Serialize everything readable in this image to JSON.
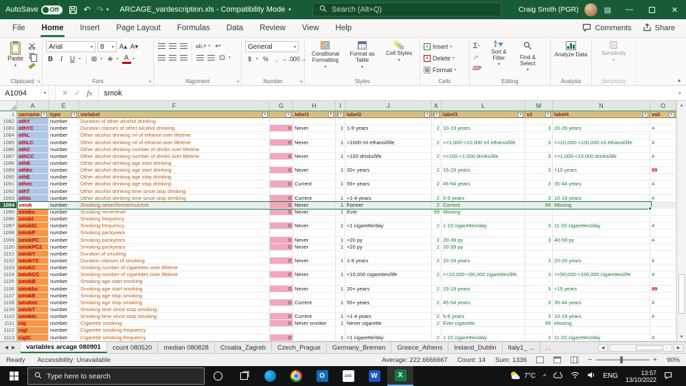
{
  "title_bar": {
    "autosave_label": "AutoSave",
    "autosave_state": "Off",
    "title": "ARCAGE_vardescription.xls  -  Compatibility Mode",
    "search_placeholder": "Search (Alt+Q)",
    "user_name": "Craig Smith (PGR)"
  },
  "menu": {
    "tabs": [
      "File",
      "Home",
      "Insert",
      "Page Layout",
      "Formulas",
      "Data",
      "Review",
      "View",
      "Help"
    ],
    "active_tab": "Home",
    "comments_label": "Comments",
    "share_label": "Share"
  },
  "ribbon": {
    "font_name": "Arial",
    "font_size": "8",
    "number_format": "General",
    "groups": [
      "Clipboard",
      "Font",
      "Alignment",
      "Number",
      "Styles",
      "Cells",
      "Editing",
      "Analysis",
      "Sensitivity"
    ],
    "buttons": {
      "paste": "Paste",
      "conditional": "Conditional Formatting",
      "format_table": "Format as Table",
      "cell_styles": "Cell Styles",
      "insert": "Insert",
      "delete": "Delete",
      "format": "Format",
      "sort_filter": "Sort & Filter",
      "find_select": "Find & Select",
      "analyze": "Analyze Data",
      "sensitivity": "Sensitivity"
    }
  },
  "formula_bar": {
    "name_box": "A1094",
    "fx": "fx",
    "content": "smok"
  },
  "grid": {
    "columns": [
      "A",
      "E",
      "F",
      "G",
      "H",
      "I",
      "J",
      "K",
      "L",
      "M",
      "N",
      "O"
    ],
    "header_row": {
      "num": "1",
      "cells": [
        "varname",
        "type",
        "varlabel",
        "",
        "label1",
        "v",
        "label2",
        "v",
        "label3",
        "v2",
        "label4",
        "vali"
      ]
    },
    "rows": [
      {
        "num": "1082",
        "ac": "b",
        "a": "othY",
        "e": "number",
        "f": "Duration of other alcohol drinking"
      },
      {
        "num": "1083",
        "ac": "b",
        "a": "othYC",
        "e": "number",
        "f": "Duration classes of other alcohol drinking",
        "g": "0",
        "h": "Never",
        "i": "1",
        "j": "1-9 years",
        "k": "2",
        "l": "10-19 years",
        "m": "3",
        "n": "20-29 years",
        "o": "4"
      },
      {
        "num": "1084",
        "ac": "b",
        "a": "othL",
        "e": "number",
        "f": "Other alcohol drinking ml of ethanol over lifetime"
      },
      {
        "num": "1085",
        "ac": "b",
        "a": "othLC",
        "e": "number",
        "f": "Other alcohol drinking ml of ethanol over lifetime",
        "g": "0",
        "h": "Never",
        "i": "1",
        "j": "<1000 ml ethanol/life",
        "k": "2",
        "l": ">=1,000-<10,000 ml ethanol/life",
        "m": "3",
        "n": ">=10,000-<100,000 ml ethanol/life",
        "o": "4"
      },
      {
        "num": "1086",
        "ac": "b",
        "a": "othC",
        "e": "number",
        "f": "Other alcohol drinking number of drinks over lifetime"
      },
      {
        "num": "1087",
        "ac": "b",
        "a": "othCC",
        "e": "number",
        "f": "Other alcohol drinking number of drinks over lifetime",
        "g": "0",
        "h": "Never",
        "i": "1",
        "j": "<100 drinks/life",
        "k": "2",
        "l": ">=100-<1,000 drinks/life",
        "m": "3",
        "n": ">=1,000-<10,000 drinks/life",
        "o": "4"
      },
      {
        "num": "1088",
        "ac": "b",
        "a": "othB",
        "e": "number",
        "f": "Other alcohol drinking age start drinking"
      },
      {
        "num": "1089",
        "ac": "b",
        "a": "othbc",
        "e": "number",
        "f": "Other alcohol drinking age start drinking",
        "g": "0",
        "h": "Never",
        "i": "1",
        "j": "20+ years",
        "k": "2",
        "l": "15-19 years",
        "m": "3",
        "n": "<15 years",
        "o": "99"
      },
      {
        "num": "1090",
        "ac": "b",
        "a": "othE",
        "e": "number",
        "f": "Other alcohol drinking age stop drinking"
      },
      {
        "num": "1091",
        "ac": "b",
        "a": "othec",
        "e": "number",
        "f": "Other alcohol drinking age stop drinking",
        "g": "0",
        "h": "Current",
        "i": "1",
        "j": "55+ years",
        "k": "2",
        "l": "45-54 years",
        "m": "3",
        "n": "35-44 years",
        "o": "4"
      },
      {
        "num": "1092",
        "ac": "b",
        "a": "othT",
        "e": "number",
        "f": "Other alcohol drinking time since stop drinking"
      },
      {
        "num": "1093",
        "ac": "b",
        "a": "othtc",
        "e": "number",
        "f": "Other alcohol drinking time since stop drinking",
        "g": "0",
        "h": "Current",
        "i": "1",
        "j": ">1-4 years",
        "k": "2",
        "l": "5-9 years",
        "m": "3",
        "n": "10-19 years",
        "o": "4"
      },
      {
        "num": "1094",
        "ac": "s",
        "sel": true,
        "a": "smok",
        "e": "number",
        "f": "Smoking never/former/current",
        "g": "0",
        "h": "Never",
        "i": "1",
        "j": "Former",
        "k": "2",
        "l": "Current",
        "m": "99",
        "n": "Missing"
      },
      {
        "num": "1095",
        "ac": "o",
        "a": "smoks",
        "e": "number",
        "f": "Smoking never/ever",
        "g": "0",
        "h": "Never",
        "i": "1",
        "j": "Ever",
        "k": "99",
        "l": "Missing"
      },
      {
        "num": "1096",
        "ac": "o",
        "a": "smokl",
        "e": "number",
        "f": "Smoking frequency"
      },
      {
        "num": "1097",
        "ac": "o",
        "a": "smoklC",
        "e": "number",
        "f": "Smoking frequency",
        "g": "0",
        "h": "Never",
        "i": "1",
        "j": "<1 cigarette/day",
        "k": "2",
        "l": "1-10 cigarettes/day",
        "m": "3",
        "n": "11-20 cigarettes/day",
        "o": "4"
      },
      {
        "num": "1098",
        "ac": "o",
        "a": "smokP",
        "e": "number",
        "f": "Smoking packyears"
      },
      {
        "num": "1099",
        "ac": "o",
        "a": "smokPC",
        "e": "number",
        "f": "Smoking packyears",
        "g": "0",
        "h": "Never",
        "i": "1",
        "j": "<20 py",
        "k": "2",
        "l": "20-39 py",
        "m": "3",
        "n": "40-59 py",
        "o": "4"
      },
      {
        "num": "1100",
        "ac": "o",
        "a": "smokPC2",
        "e": "number",
        "f": "Smoking packyears",
        "g": "0",
        "h": "Never",
        "i": "1",
        "j": "<20 py",
        "k": "2",
        "l": "20-39 py"
      },
      {
        "num": "1101",
        "ac": "o",
        "a": "smokY",
        "e": "number",
        "f": "Duration of smoking"
      },
      {
        "num": "1102",
        "ac": "o",
        "a": "smokYC",
        "e": "number",
        "f": "Duration classes of smoking",
        "g": "0",
        "h": "Never",
        "i": "1",
        "j": "1-9 years",
        "k": "2",
        "l": "10-19 years",
        "m": "3",
        "n": "20-29 years",
        "o": "4"
      },
      {
        "num": "1103",
        "ac": "o",
        "a": "smokC",
        "e": "number",
        "f": "Smoking number of cigarettes over lifetime"
      },
      {
        "num": "1104",
        "ac": "o",
        "a": "smokCC",
        "e": "number",
        "f": "Smoking number of cigarettes over lifetime",
        "g": "0",
        "h": "Never",
        "i": "1",
        "j": "<10,000 cigarettes/life",
        "k": "2",
        "l": ">=10,000-<50,000 cigarettes/life",
        "m": "3",
        "n": ">=50,000-<100,000 cigarettes/life",
        "o": "4"
      },
      {
        "num": "1105",
        "ac": "o",
        "a": "smokB",
        "e": "number",
        "f": "Smoking age start smoking"
      },
      {
        "num": "1106",
        "ac": "o",
        "a": "smokbc",
        "e": "number",
        "f": "Smoking age start smoking",
        "g": "0",
        "h": "Never",
        "i": "1",
        "j": "20+ years",
        "k": "2",
        "l": "15-19 years",
        "m": "3",
        "n": "<15 years",
        "o": "99"
      },
      {
        "num": "1107",
        "ac": "o",
        "a": "smokE",
        "e": "number",
        "f": "Smoking age stop smoking"
      },
      {
        "num": "1108",
        "ac": "o",
        "a": "smokec",
        "e": "number",
        "f": "Smoking age stop smoking",
        "g": "0",
        "h": "Current",
        "i": "1",
        "j": "55+ years",
        "k": "2",
        "l": "45-54 years",
        "m": "3",
        "n": "35-44 years",
        "o": "4"
      },
      {
        "num": "1109",
        "ac": "o",
        "a": "smokT",
        "e": "number",
        "f": "Smoking time since stop smoking"
      },
      {
        "num": "1110",
        "ac": "o",
        "a": "smoktc",
        "e": "number",
        "f": "Smoking time since stop smoking",
        "g": "0",
        "h": "Current",
        "i": "1",
        "j": ">1-4 years",
        "k": "2",
        "l": "5-9 years",
        "m": "3",
        "n": "10-19 years",
        "o": "4"
      },
      {
        "num": "1111",
        "ac": "o",
        "a": "cig",
        "e": "number",
        "f": "Cigarette smoking",
        "g": "0",
        "h": "Never smoker",
        "i": "1",
        "j": "Never cigarette",
        "k": "2",
        "l": "Ever cigarette",
        "m": "99",
        "n": "Missing"
      },
      {
        "num": "1112",
        "ac": "o",
        "a": "cigl",
        "e": "number",
        "f": "Cigarette smoking frequency"
      },
      {
        "num": "1113",
        "ac": "o",
        "a": "ciglC",
        "e": "number",
        "f": "Cigarette smoking frequency",
        "g": "0",
        "h": "",
        "i": "1",
        "j": "<1 cigarette/day",
        "k": "2",
        "l": "1-10 cigarettes/day",
        "m": "3",
        "n": "11-20 cigarettes/day",
        "o": "4"
      }
    ]
  },
  "sheet_tabs": {
    "tabs": [
      "variables arcage 080901",
      "count 080520",
      "median 080828",
      "Croatia_Zagreb",
      "Czech_Prague",
      "Germany_Bremen",
      "Greece_Athens",
      "Ireland_Dublin",
      "Italy1_ ..."
    ],
    "active": "variables arcage 080901"
  },
  "status_bar": {
    "mode": "Ready",
    "accessibility": "Accessibility: Unavailable",
    "average": "Average: 222.6666667",
    "count": "Count: 14",
    "sum": "Sum: 1336",
    "zoom": "90%"
  },
  "taskbar": {
    "search_placeholder": "Type here to search",
    "weather": "7°C",
    "lang": "ENG",
    "time": "13:57",
    "date": "13/10/2022"
  },
  "colors": {
    "titlebar_green": "#185c37",
    "accent_green": "#217346",
    "header_tan": "#d4bf85",
    "varname_blue": "#aec6e8",
    "varname_orange": "#f79646",
    "code_pink": "#f2a7bc",
    "label_green": "#1d7a34",
    "value_red": "#d00000",
    "varlabel_brown": "#b85b10"
  }
}
